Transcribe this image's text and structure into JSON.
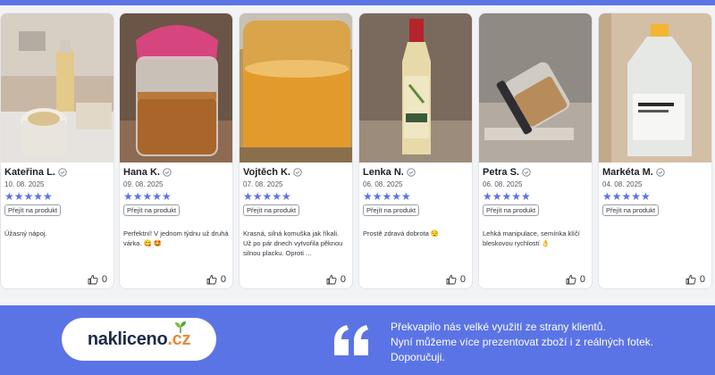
{
  "reviews": [
    {
      "name": "Kateřina L.",
      "date": "10. 08. 2025",
      "rating": 5,
      "stars": "★★★★★",
      "product_button": "Přejít na produkt",
      "text": "Úžasný nápoj.",
      "likes": "0"
    },
    {
      "name": "Hana K.",
      "date": "09. 08. 2025",
      "rating": 5,
      "stars": "★★★★★",
      "product_button": "Přejít na produkt",
      "text": "Perfektní! V jednom týdnu už druhá várka. 😋 🤩",
      "likes": "0"
    },
    {
      "name": "Vojtěch K.",
      "date": "07. 08. 2025",
      "rating": 5,
      "stars": "★★★★★",
      "product_button": "Přejít na produkt",
      "text": "Krasná, silná komuška jak říkali. Už po pár dnech vytvořila pěknou silnou placku. Oproti ...",
      "likes": "0"
    },
    {
      "name": "Lenka N.",
      "date": "06. 08. 2025",
      "rating": 5,
      "stars": "★★★★★",
      "product_button": "Přejít na produkt",
      "text": "Prostě zdravá dobrota 😌",
      "likes": "0"
    },
    {
      "name": "Petra S.",
      "date": "06. 08. 2025",
      "rating": 5,
      "stars": "★★★★★",
      "product_button": "Přejít na produkt",
      "text": "Lehká manipulace, semínka klíčí bleskovou rychlostí 👌",
      "likes": "0"
    },
    {
      "name": "Markéta M.",
      "date": "04. 08. 2025",
      "rating": 5,
      "stars": "★★★★★",
      "product_button": "Přejít na produkt",
      "text": "",
      "likes": "0"
    }
  ],
  "banner": {
    "logo_main": "nakliceno",
    "logo_tld": ".cz",
    "testimonial_lines": [
      "Překvapilo nás velké využití ze strany klientů.",
      "Nyní můžeme více prezentovat zboží i z reálných fotek.",
      "Doporučuji."
    ]
  },
  "colors": {
    "accent": "#5b74e5",
    "logo_orange": "#e8893a",
    "logo_navy": "#1e2a4a"
  },
  "icons": {
    "verified": "verified-check-icon",
    "like": "thumbs-up-icon",
    "quote": "quote-icon",
    "sprout": "sprout-icon"
  }
}
